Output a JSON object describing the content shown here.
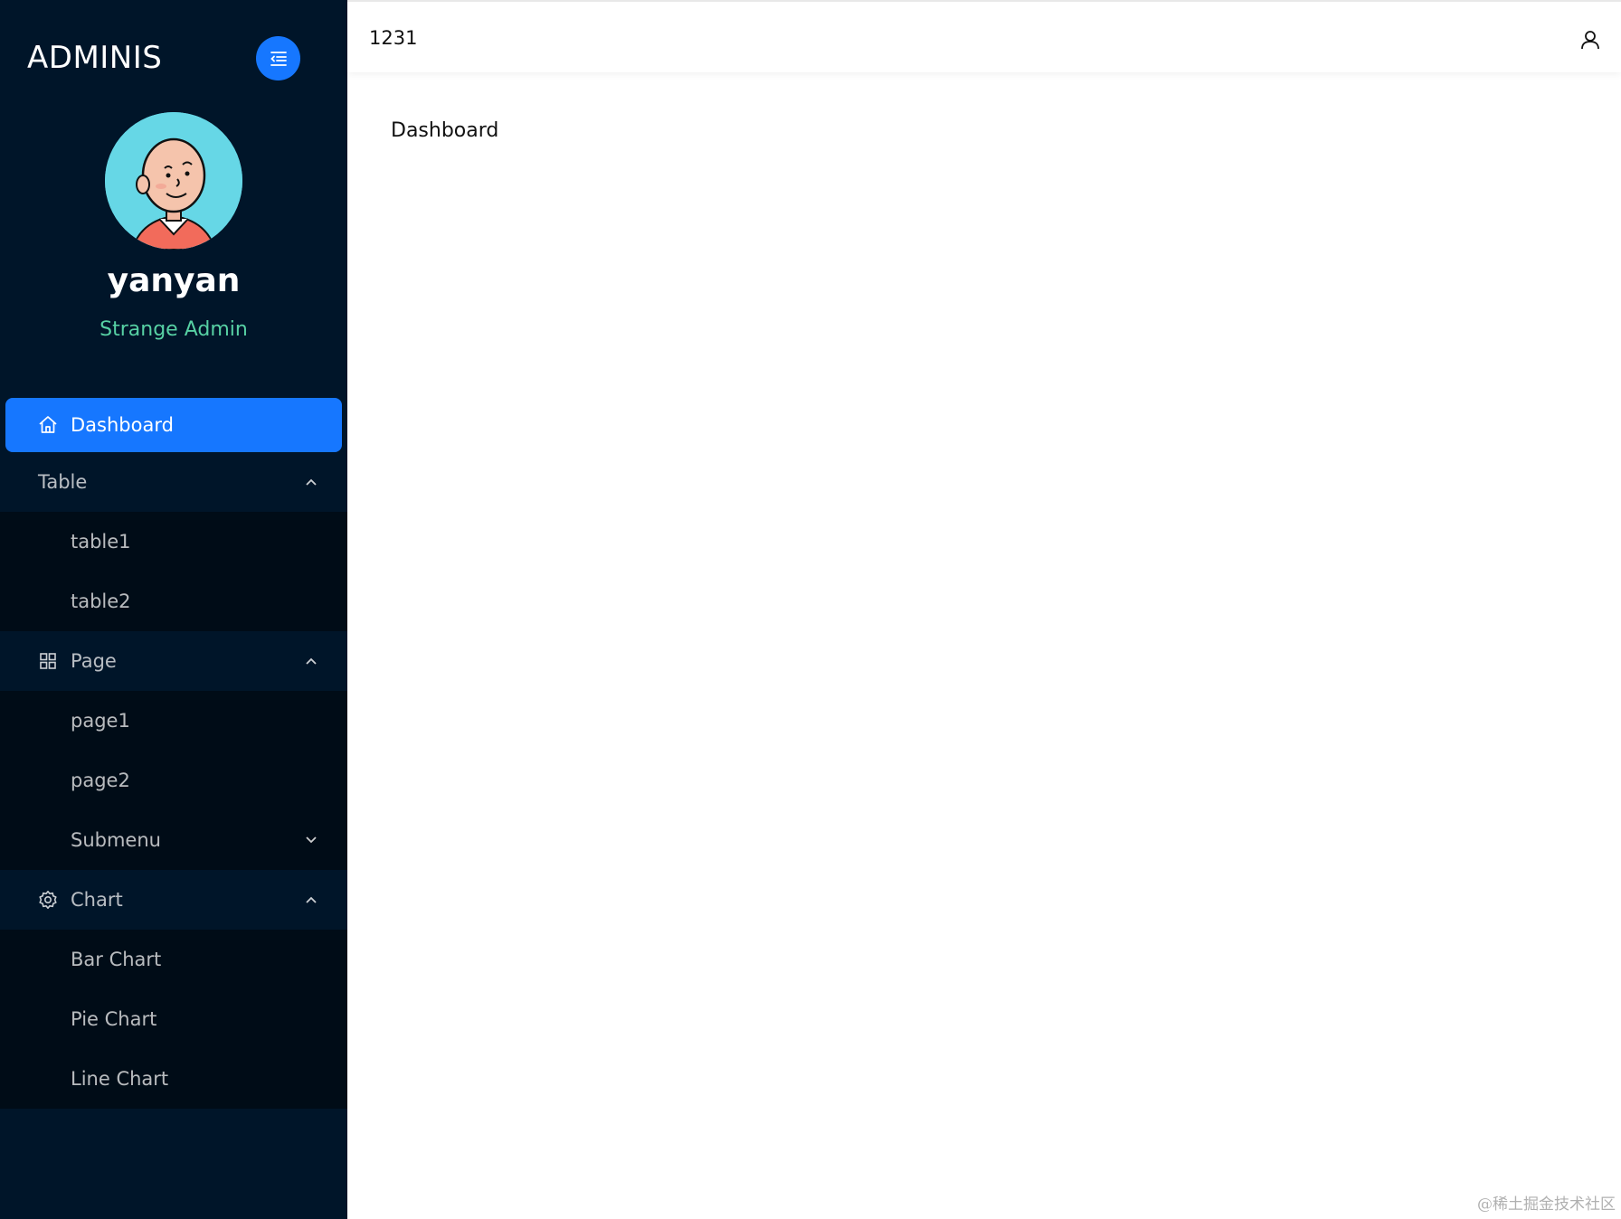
{
  "brand": "ADMINIS",
  "profile": {
    "name": "yanyan",
    "role": "Strange Admin"
  },
  "menu": {
    "dashboard": "Dashboard",
    "table": {
      "label": "Table",
      "items": [
        "table1",
        "table2"
      ]
    },
    "page": {
      "label": "Page",
      "items": [
        "page1",
        "page2"
      ],
      "submenu": "Submenu"
    },
    "chart": {
      "label": "Chart",
      "items": [
        "Bar Chart",
        "Pie Chart",
        "Line Chart"
      ]
    }
  },
  "header": {
    "text": "1231"
  },
  "content": {
    "title": "Dashboard"
  },
  "watermark": "@稀土掘金技术社区",
  "colors": {
    "sidebar_bg": "#001529",
    "submenu_bg": "#000c17",
    "accent": "#1677ff",
    "role_text": "#57d1a4"
  },
  "icons": {
    "toggle": "menu-fold-icon",
    "dashboard": "home-icon",
    "page": "appstore-icon",
    "chart": "setting-icon",
    "user": "user-icon"
  }
}
